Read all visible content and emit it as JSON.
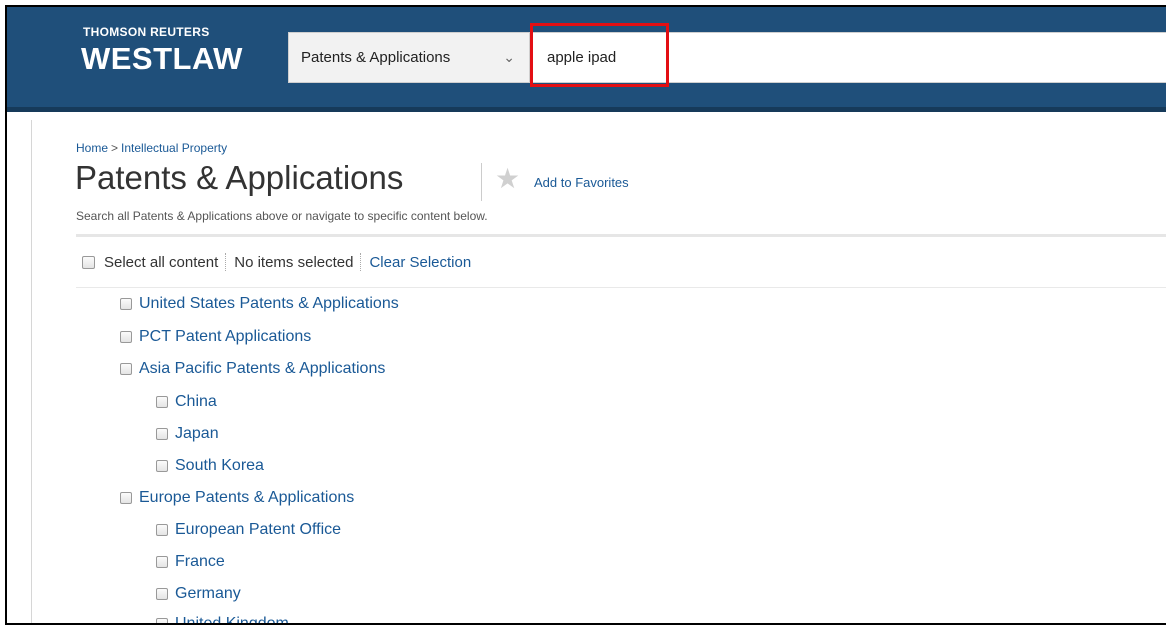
{
  "header": {
    "logo_top": "THOMSON REUTERS",
    "logo_main": "WESTLAW",
    "content_select": {
      "value": "Patents & Applications"
    },
    "search": {
      "value": "apple ipad"
    },
    "highlight_color": "#e30f13",
    "bg_color": "#1f4f7a"
  },
  "breadcrumb": {
    "home": "Home",
    "separator": ">",
    "current": "Intellectual Property"
  },
  "page": {
    "title": "Patents & Applications",
    "add_favorites": "Add to Favorites",
    "subtitle": "Search all Patents & Applications above or navigate to specific content below."
  },
  "selection_bar": {
    "select_all": "Select all content",
    "status": "No items selected",
    "clear": "Clear Selection"
  },
  "tree": [
    {
      "label": "United States Patents & Applications",
      "level": 1
    },
    {
      "label": "PCT Patent Applications",
      "level": 1
    },
    {
      "label": "Asia Pacific Patents & Applications",
      "level": 1
    },
    {
      "label": "China",
      "level": 2
    },
    {
      "label": "Japan",
      "level": 2
    },
    {
      "label": "South Korea",
      "level": 2
    },
    {
      "label": "Europe Patents & Applications",
      "level": 1
    },
    {
      "label": "European Patent Office",
      "level": 2
    },
    {
      "label": "France",
      "level": 2
    },
    {
      "label": "Germany",
      "level": 2
    },
    {
      "label": "United Kingdom",
      "level": 2
    }
  ]
}
